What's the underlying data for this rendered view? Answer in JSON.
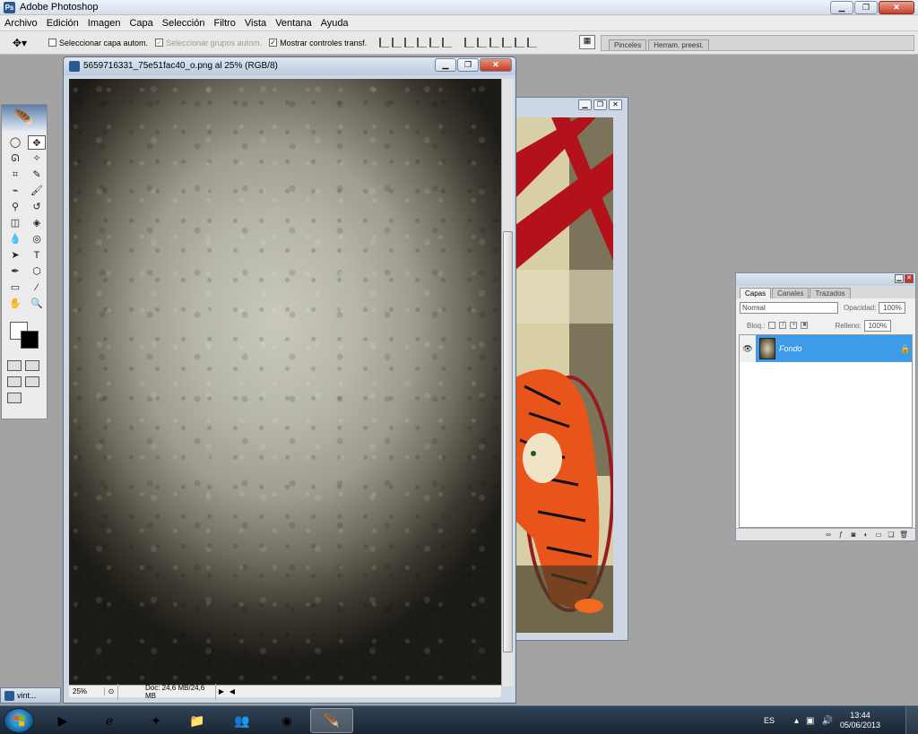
{
  "app": {
    "title": "Adobe Photoshop"
  },
  "menu": [
    "Archivo",
    "Edición",
    "Imagen",
    "Capa",
    "Selección",
    "Filtro",
    "Vista",
    "Ventana",
    "Ayuda"
  ],
  "options": {
    "auto_select_layer": "Seleccionar capa autom.",
    "auto_select_groups": "Seleccionar grupos autom.",
    "show_transform": "Mostrar controles transf.",
    "wells": [
      "Pinceles",
      "Herram. preest."
    ]
  },
  "document": {
    "title": "5659716331_75e51fac40_o.png al 25% (RGB/8)",
    "zoom": "25%",
    "doc_size": "Doc: 24,6 MB/24,6 MB"
  },
  "layers_panel": {
    "tabs": [
      "Capas",
      "Canales",
      "Trazados"
    ],
    "blend_mode": "Normal",
    "opacity_label": "Opacidad:",
    "opacity": "100%",
    "lock_label": "Bloq.:",
    "fill_label": "Relleno:",
    "fill": "100%",
    "layers": [
      {
        "name": "Fondo",
        "selected": true,
        "locked": true
      }
    ],
    "selected_color": "#3d9bea"
  },
  "minimized_doc": "vint...",
  "taskbar": {
    "language": "ES",
    "time": "13:44",
    "date": "05/06/2013"
  }
}
